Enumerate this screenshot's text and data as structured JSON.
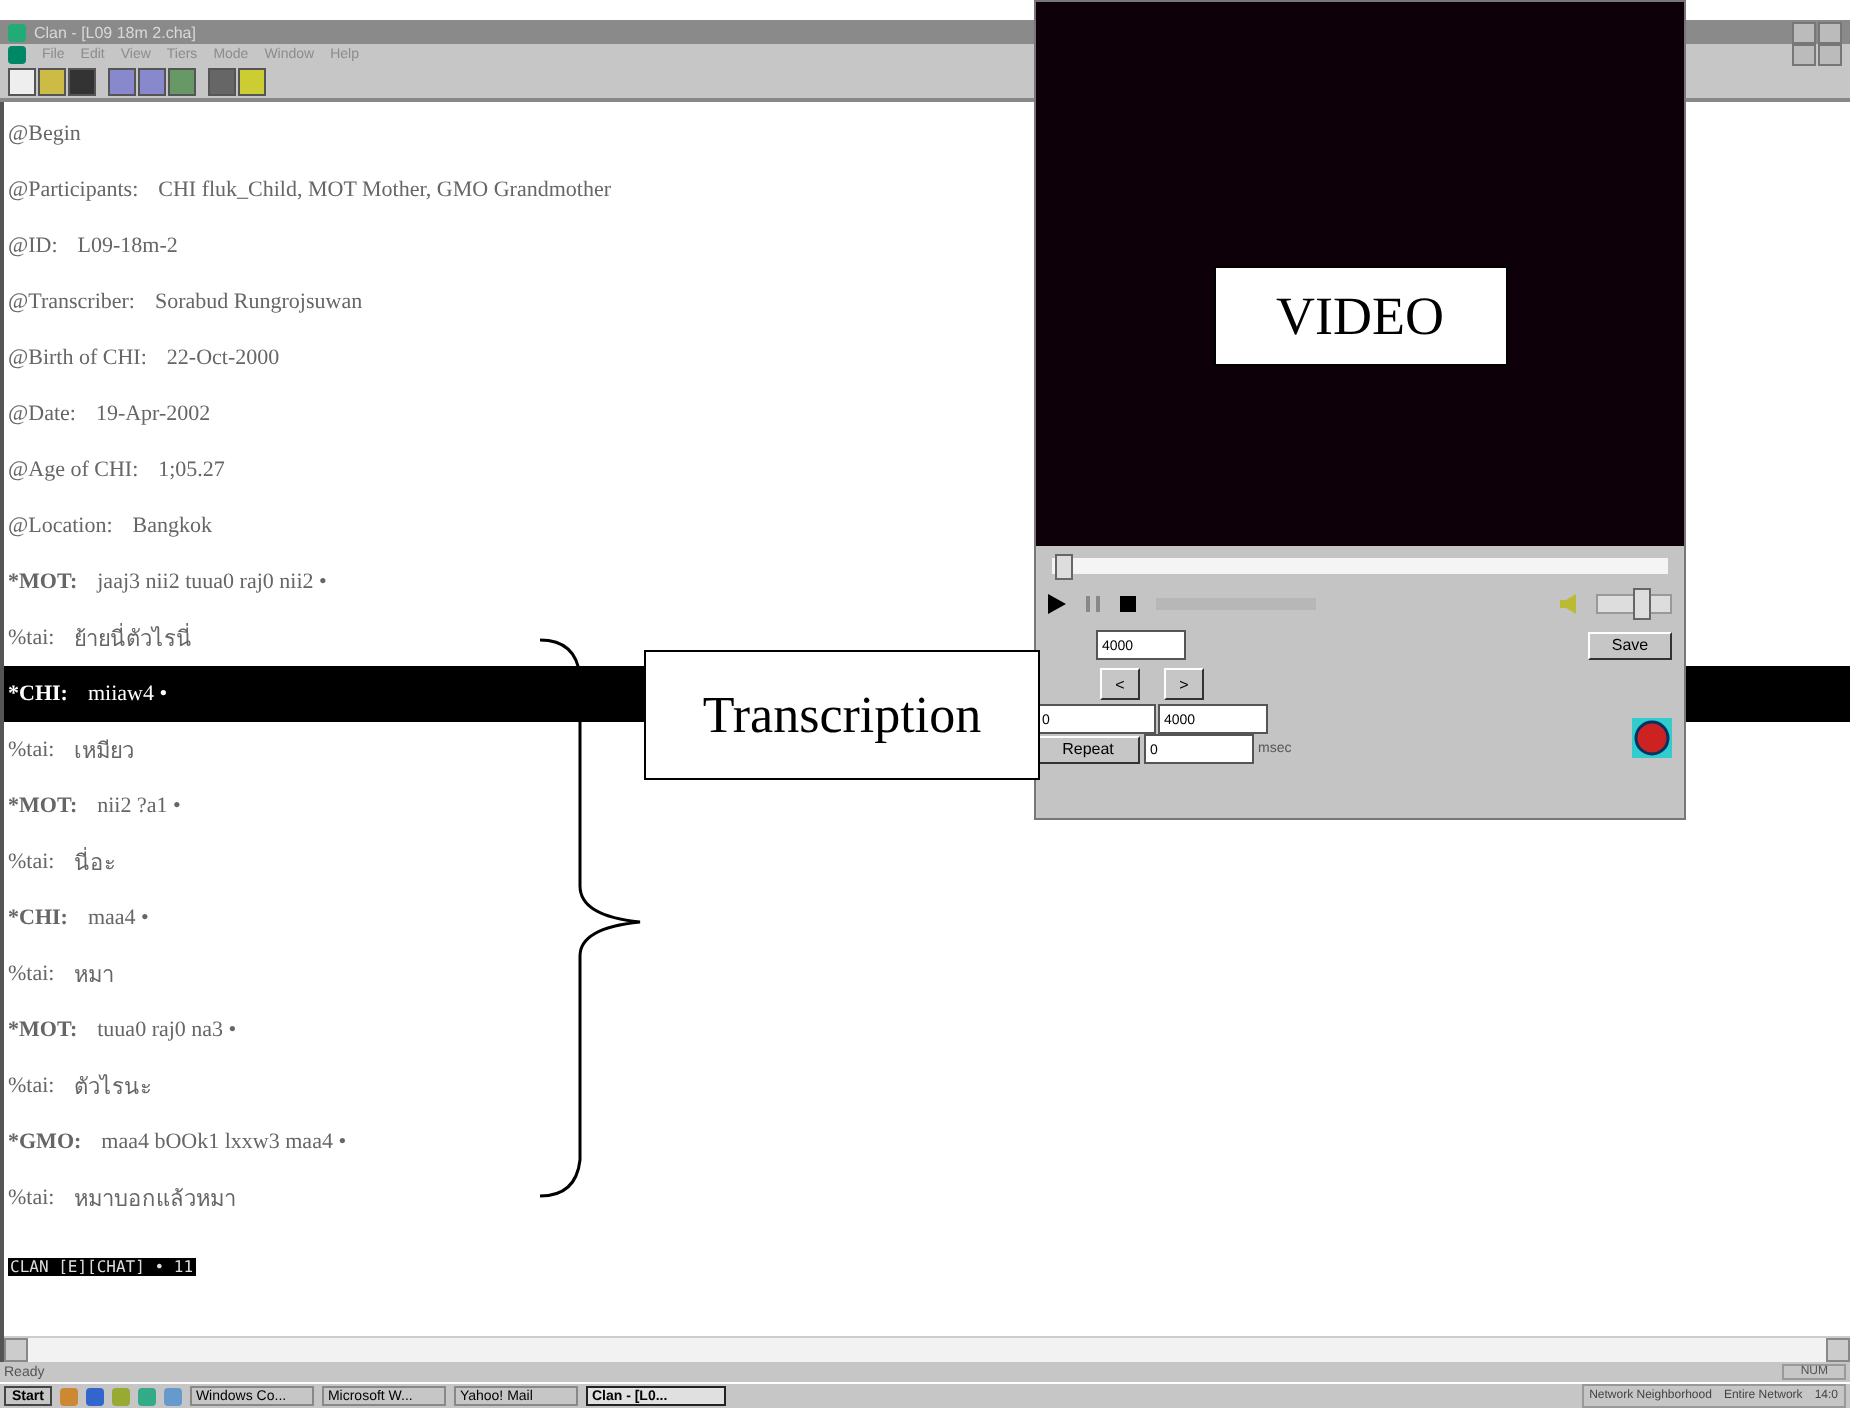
{
  "window": {
    "title": "Clan - [L09 18m 2.cha]"
  },
  "menu": [
    "File",
    "Edit",
    "View",
    "Tiers",
    "Mode",
    "Window",
    "Help"
  ],
  "transcript": [
    {
      "kind": "header",
      "label": "@Begin",
      "selected": false
    },
    {
      "kind": "header",
      "label": "@Participants:",
      "text": "CHI fluk_Child, MOT Mother, GMO Grandmother",
      "selected": false
    },
    {
      "kind": "header",
      "label": "@ID:",
      "text": "L09-18m-2",
      "selected": false
    },
    {
      "kind": "header",
      "label": "@Transcriber:",
      "text": "Sorabud Rungrojsuwan",
      "selected": false
    },
    {
      "kind": "header",
      "label": "@Birth of CHI:",
      "text": "22-Oct-2000",
      "selected": false
    },
    {
      "kind": "header",
      "label": "@Date:",
      "text": "19-Apr-2002",
      "selected": false
    },
    {
      "kind": "header",
      "label": "@Age of CHI:",
      "text": "1;05.27",
      "selected": false
    },
    {
      "kind": "header",
      "label": "@Location:",
      "text": "Bangkok",
      "selected": false
    },
    {
      "kind": "speaker",
      "label": "*MOT:",
      "text": "jaaj3 nii2 tuua0 raj0 nii2 •",
      "selected": false
    },
    {
      "kind": "tier",
      "label": "%tai:",
      "text": "ย้ายนี่ตัวไรนี่",
      "selected": false
    },
    {
      "kind": "speaker",
      "label": "*CHI:",
      "text": "miiaw4 •",
      "selected": true
    },
    {
      "kind": "tier",
      "label": "%tai:",
      "text": "เหมียว",
      "selected": false
    },
    {
      "kind": "speaker",
      "label": "*MOT:",
      "text": "nii2 ?a1 •",
      "selected": false
    },
    {
      "kind": "tier",
      "label": "%tai:",
      "text": "นี่อะ",
      "selected": false
    },
    {
      "kind": "speaker",
      "label": "*CHI:",
      "text": "maa4 •",
      "selected": false
    },
    {
      "kind": "tier",
      "label": "%tai:",
      "text": "หมา",
      "selected": false
    },
    {
      "kind": "speaker",
      "label": "*MOT:",
      "text": "tuua0 raj0 na3 •",
      "selected": false
    },
    {
      "kind": "tier",
      "label": "%tai:",
      "text": "ตัวไรนะ",
      "selected": false
    },
    {
      "kind": "speaker",
      "label": "*GMO:",
      "text": "maa4 bOOk1 lxxw3 maa4 •",
      "selected": false
    },
    {
      "kind": "tier",
      "label": "%tai:",
      "text": "หมาบอกแล้วหมา",
      "selected": false
    }
  ],
  "mode_line": "CLAN [E][CHAT] • 11",
  "status_bar": {
    "text": "Ready",
    "indicator": "NUM"
  },
  "video_window": {
    "label": "VIDEO",
    "seek": {
      "level": 0.02
    },
    "volume": {
      "level": 0.6
    },
    "duration_field": "4000",
    "prev_button": "<",
    "next_button": ">",
    "start_field": "0",
    "end_field": "4000",
    "save_button": "Save",
    "repeat_button": "Repeat",
    "repeat_field": "0",
    "unit": "msec"
  },
  "annotation": {
    "label": "Transcription"
  },
  "taskbar": {
    "start": "Start",
    "tasks": [
      {
        "label": "Windows Co...",
        "selected": false
      },
      {
        "label": "Microsoft W...",
        "selected": false
      },
      {
        "label": "Yahoo! Mail",
        "selected": false
      },
      {
        "label": "Clan - [L0...",
        "selected": true
      }
    ],
    "tray_items": [
      "Network Neighborhood",
      "Entire Network"
    ],
    "clock": "14:0"
  }
}
